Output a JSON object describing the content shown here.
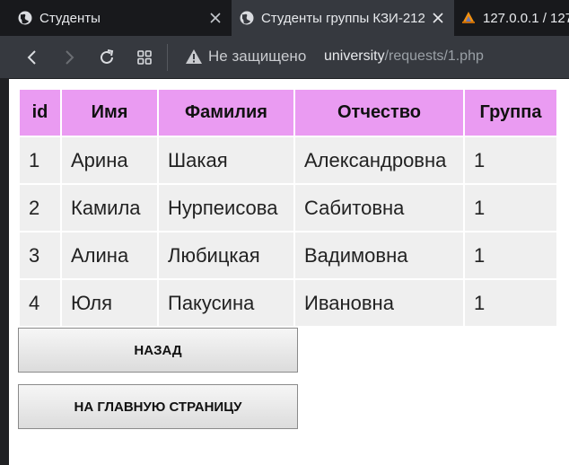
{
  "browser": {
    "tabs": [
      {
        "title": "Студенты",
        "active": false,
        "icon": "globe-icon"
      },
      {
        "title": "Студенты группы КЗИ-212",
        "active": true,
        "icon": "globe-icon"
      },
      {
        "title": "127.0.0.1 / 127",
        "active": false,
        "icon": "phpmyadmin-icon"
      }
    ],
    "security_label": "Не защищено",
    "url_host": "university",
    "url_path": "/requests/1.php"
  },
  "table": {
    "headers": [
      "id",
      "Имя",
      "Фамилия",
      "Отчество",
      "Группа"
    ],
    "rows": [
      [
        "1",
        "Арина",
        "Шакая",
        "Александровна",
        "1"
      ],
      [
        "2",
        "Камила",
        "Нурпеисова",
        "Сабитовна",
        "1"
      ],
      [
        "3",
        "Алина",
        "Любицкая",
        "Вадимовна",
        "1"
      ],
      [
        "4",
        "Юля",
        "Пакусина",
        "Ивановна",
        "1"
      ]
    ]
  },
  "buttons": {
    "back": "НАЗАД",
    "home": "НА ГЛАВНУЮ СТРАНИЦУ"
  },
  "colors": {
    "header_bg": "#ea9bf2",
    "cell_bg": "#efefef",
    "tabstrip_bg": "#18191c",
    "toolbar_bg": "#36393f"
  }
}
